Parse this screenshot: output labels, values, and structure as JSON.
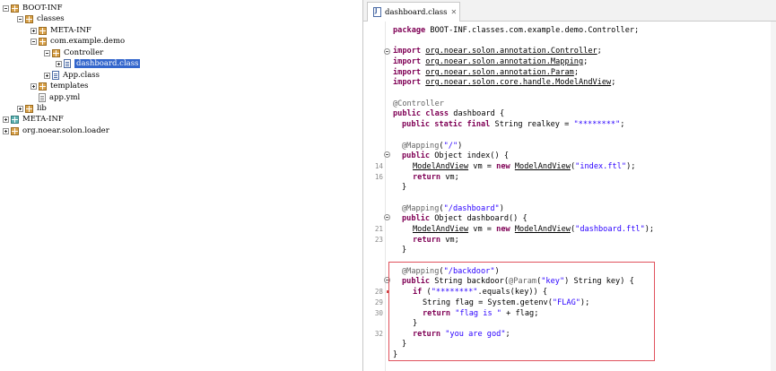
{
  "tree": {
    "items": [
      {
        "label": "BOOT-INF",
        "kind": "package"
      },
      {
        "label": "classes",
        "kind": "package"
      },
      {
        "label": "META-INF",
        "kind": "package"
      },
      {
        "label": "com.example.demo",
        "kind": "package"
      },
      {
        "label": "Controller",
        "kind": "package"
      },
      {
        "label": "dashboard.class",
        "kind": "class",
        "selected": true
      },
      {
        "label": "App.class",
        "kind": "class"
      },
      {
        "label": "templates",
        "kind": "package"
      },
      {
        "label": "app.yml",
        "kind": "file"
      },
      {
        "label": "lib",
        "kind": "package"
      },
      {
        "label": "META-INF",
        "kind": "package-teal"
      },
      {
        "label": "org.noear.solon.loader",
        "kind": "package"
      }
    ]
  },
  "editor": {
    "tab_label": "dashboard.class",
    "tab_close": "✕",
    "line_numbers": {
      "l14": "14",
      "l16": "16",
      "l21": "21",
      "l23": "23",
      "l28": "28",
      "l29": "29",
      "l30": "30",
      "l32": "32"
    },
    "code": {
      "package_kw": "package",
      "package_name": "BOOT-INF.classes.com.example.demo.Controller;",
      "import_kw": "import",
      "imp1": "org.noear.solon.annotation.Controller",
      "imp2": "org.noear.solon.annotation.Mapping",
      "imp3": "org.noear.solon.annotation.Param",
      "imp4": "org.noear.solon.core.handle.ModelAndView",
      "semi": ";",
      "ann_controller": "@Controller",
      "cls_public": "public",
      "cls_class": "class",
      "cls_name": " dashboard {",
      "field_public": "public",
      "field_static": "static",
      "field_final": "final",
      "field_type": " String ",
      "field_name": "realkey",
      "field_eq": " = ",
      "field_val": "\"********\"",
      "ann_map1": "@Mapping",
      "map1_paren_open": "(",
      "map1_val": "\"/\"",
      "paren_close": ")",
      "m1_public": "public",
      "m1_sig": " Object index() {",
      "mav": "ModelAndView",
      "vm_eq": " vm = ",
      "new_kw": "new",
      "m1_call_open": "(",
      "m1_ftl": "\"index.ftl\"",
      "call_close": ");",
      "return_kw": "return",
      "ret_vm": " vm;",
      "brace_close": "}",
      "map2_val": "\"/dashboard\"",
      "m2_sig": " Object dashboard() {",
      "m2_ftl": "\"dashboard.ftl\"",
      "map3_val": "\"/backdoor\"",
      "m3_type": " String backdoor(",
      "ann_param": "@Param",
      "param_val": "\"key\"",
      "m3_rest": " String key) {",
      "if_kw": "if",
      "if_open": " (",
      "if_str": "\"********\"",
      "if_rest": ".equals(key)) {",
      "flag_decl": "String flag = System.getenv(",
      "flag_val": "\"FLAG\"",
      "ret_flag_str": "\"flag is \"",
      "ret_flag_rest": " + flag;",
      "god_str": "\"you are god\""
    }
  },
  "colors": {
    "keyword": "#7f0055",
    "string": "#2a00ff",
    "annotation": "#646464",
    "highlight": "#e0525d",
    "selection": "#3366cc"
  }
}
